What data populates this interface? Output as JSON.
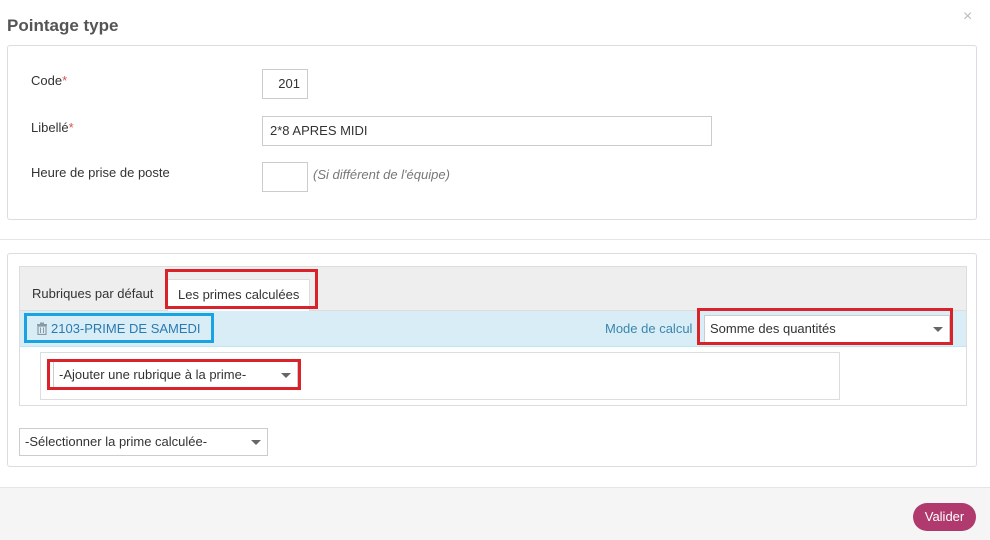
{
  "modal": {
    "title": "Pointage type",
    "close_glyph": "×"
  },
  "form": {
    "code_label": "Code",
    "code_value": "201",
    "libelle_label": "Libellé",
    "libelle_value": "2*8 APRES MIDI",
    "heure_label": "Heure de prise de poste",
    "heure_value": "",
    "heure_hint": "(Si différent de l'équipe)",
    "required_marker": "*"
  },
  "tabs": [
    {
      "label": "Rubriques par défaut",
      "active": false
    },
    {
      "label": "Les primes calculées",
      "active": true
    }
  ],
  "prime": {
    "name": "2103-PRIME DE SAMEDI",
    "mode_label": "Mode de calcul :",
    "mode_value": "Somme des quantités",
    "add_rubrique_placeholder": "-Ajouter une rubrique à la prime-"
  },
  "select_prime_placeholder": "-Sélectionner la prime calculée-",
  "footer": {
    "valider_label": "Valider"
  },
  "colors": {
    "highlight_red": "#d9222a",
    "highlight_blue": "#1aa3e0",
    "valider_button": "#b03a6e",
    "prime_row_bg": "#d9edf7",
    "required": "#d9534f"
  }
}
